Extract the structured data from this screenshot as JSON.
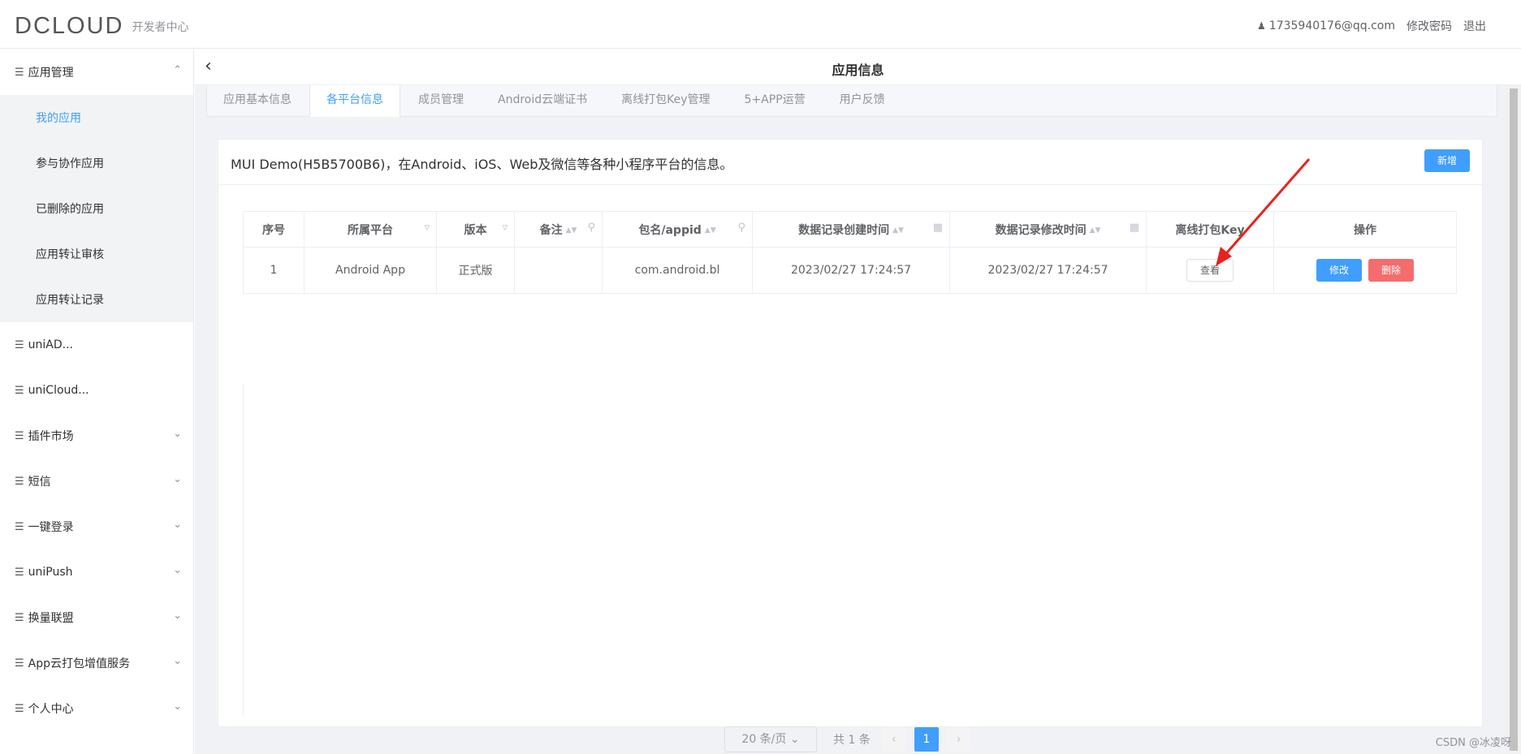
{
  "header": {
    "logo": "DCLOUD",
    "logo_sub": "开发者中心",
    "user": "1735940176@qq.com",
    "change_pwd": "修改密码",
    "logout": "退出"
  },
  "sidebar": {
    "app_mgmt": "应用管理",
    "sub_items": [
      "我的应用",
      "参与协作应用",
      "已删除的应用",
      "应用转让审核",
      "应用转让记录"
    ],
    "items": [
      "uniAD...",
      "uniCloud...",
      "插件市场",
      "短信",
      "一键登录",
      "uniPush",
      "换量联盟",
      "App云打包增值服务",
      "个人中心"
    ]
  },
  "page": {
    "title": "应用信息",
    "tabs": [
      "应用基本信息",
      "各平台信息",
      "成员管理",
      "Android云端证书",
      "离线打包Key管理",
      "5+APP运营",
      "用户反馈"
    ],
    "active_tab": "各平台信息"
  },
  "card": {
    "title": "MUI Demo(H5B5700B6)，在Android、iOS、Web及微信等各种小程序平台的信息。",
    "add_label": "新增"
  },
  "table": {
    "headers": [
      "序号",
      "所属平台",
      "版本",
      "备注",
      "包名/appid",
      "数据记录创建时间",
      "数据记录修改时间",
      "离线打包Key",
      "操作"
    ],
    "row": {
      "index": "1",
      "platform": "Android App",
      "version": "正式版",
      "remark": "",
      "package": "com.android.bl",
      "created": "2023/02/27 17:24:57",
      "modified": "2023/02/27 17:24:57",
      "view_label": "查看",
      "edit_label": "修改",
      "delete_label": "删除"
    }
  },
  "pagination": {
    "page_size": "20 条/页",
    "total": "共 1 条",
    "current": "1"
  },
  "watermark": "CSDN @冰凌呀",
  "colors": {
    "primary": "#409eff",
    "danger": "#f56c6c",
    "annotation_arrow": "#e8231c"
  }
}
